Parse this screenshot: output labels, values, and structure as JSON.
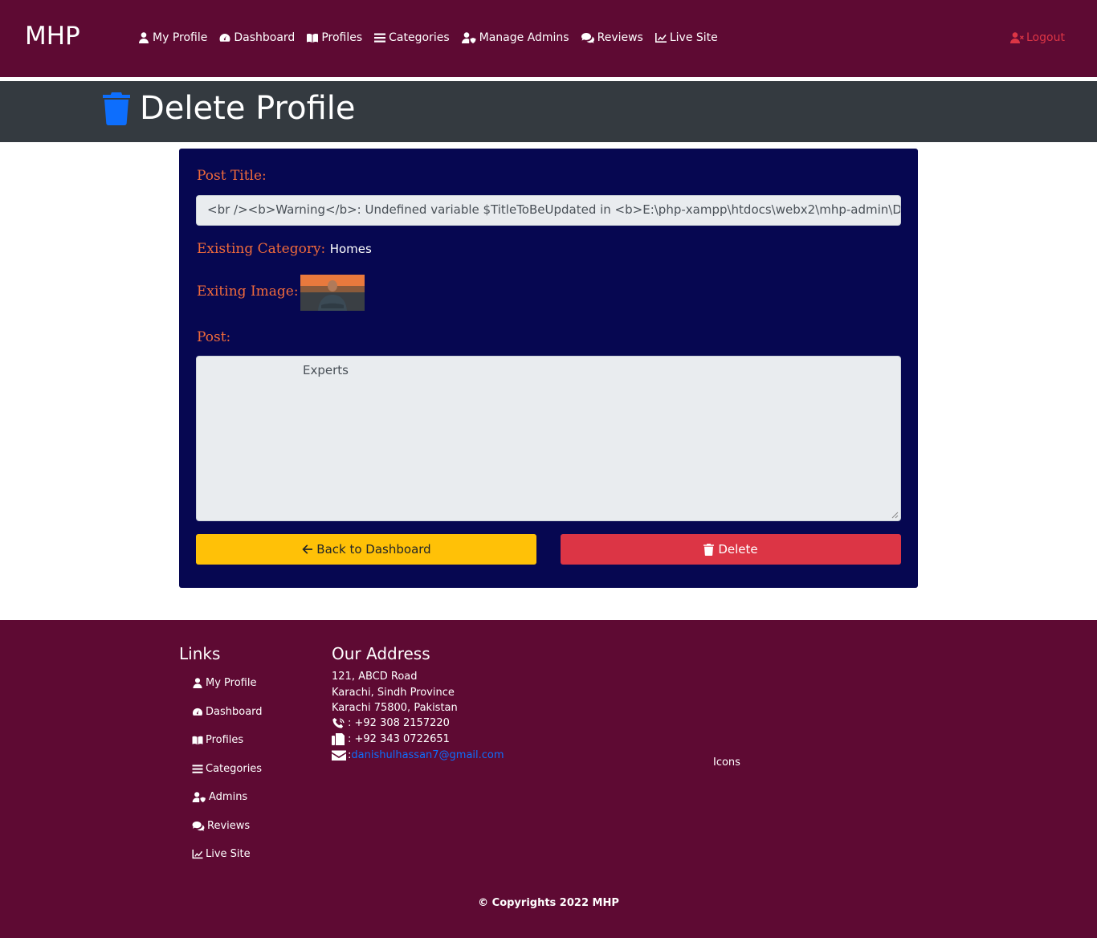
{
  "navbar": {
    "brand": "MHP",
    "items": [
      {
        "label": "My Profile",
        "icon": "user-icon"
      },
      {
        "label": "Dashboard",
        "icon": "tachometer-icon"
      },
      {
        "label": "Profiles",
        "icon": "book-icon"
      },
      {
        "label": "Categories",
        "icon": "list-icon"
      },
      {
        "label": "Manage Admins",
        "icon": "user-shield-icon"
      },
      {
        "label": "Reviews",
        "icon": "comments-icon"
      },
      {
        "label": "Live Site",
        "icon": "chart-line-icon"
      }
    ],
    "logout": "Logout"
  },
  "header": {
    "title": "Delete Profile",
    "icon": "trash-icon",
    "icon_color": "#0d6efd"
  },
  "form": {
    "post_title_label": "Post Title:",
    "post_title_value": "<br /><b>Warning</b>:  Undefined variable $TitleToBeUpdated in <b>E:\\php-xampp\\htdocs\\webx2\\mhp-admin\\DeleteProfile.php</b>",
    "existing_category_label": "Existing Category:",
    "existing_category_value": "Homes",
    "existing_image_label": "Exiting Image:",
    "post_label": "Post:",
    "post_value": "Experts",
    "back_button": "Back to Dashboard",
    "delete_button": "Delete"
  },
  "footer": {
    "links_heading": "Links",
    "links": [
      {
        "label": "My Profile",
        "icon": "user-icon"
      },
      {
        "label": "Dashboard",
        "icon": "tachometer-icon"
      },
      {
        "label": "Profiles",
        "icon": "book-icon"
      },
      {
        "label": "Categories",
        "icon": "list-icon"
      },
      {
        "label": "Admins",
        "icon": "user-shield-icon"
      },
      {
        "label": "Reviews",
        "icon": "comments-icon"
      },
      {
        "label": "Live Site",
        "icon": "chart-line-icon"
      }
    ],
    "address_heading": "Our Address",
    "address_line1": "121, ABCD Road",
    "address_line2": "Karachi, Sindh Province",
    "address_line3": "Karachi 75800, Pakistan",
    "phone": ": +92 308 2157220",
    "fax": ": +92 343 0722651",
    "email_sep": ":",
    "email": "danishulhassan7@gmail.com",
    "icons_text": "Icons",
    "copyright": "© Copyrights 2022 MHP"
  },
  "colors": {
    "navbar_bg": "#5e0a33",
    "header_bg": "#343a40",
    "card_bg": "#060751",
    "label_color": "#f06a3b",
    "back_button": "#ffc107",
    "delete_button": "#dc3545"
  }
}
